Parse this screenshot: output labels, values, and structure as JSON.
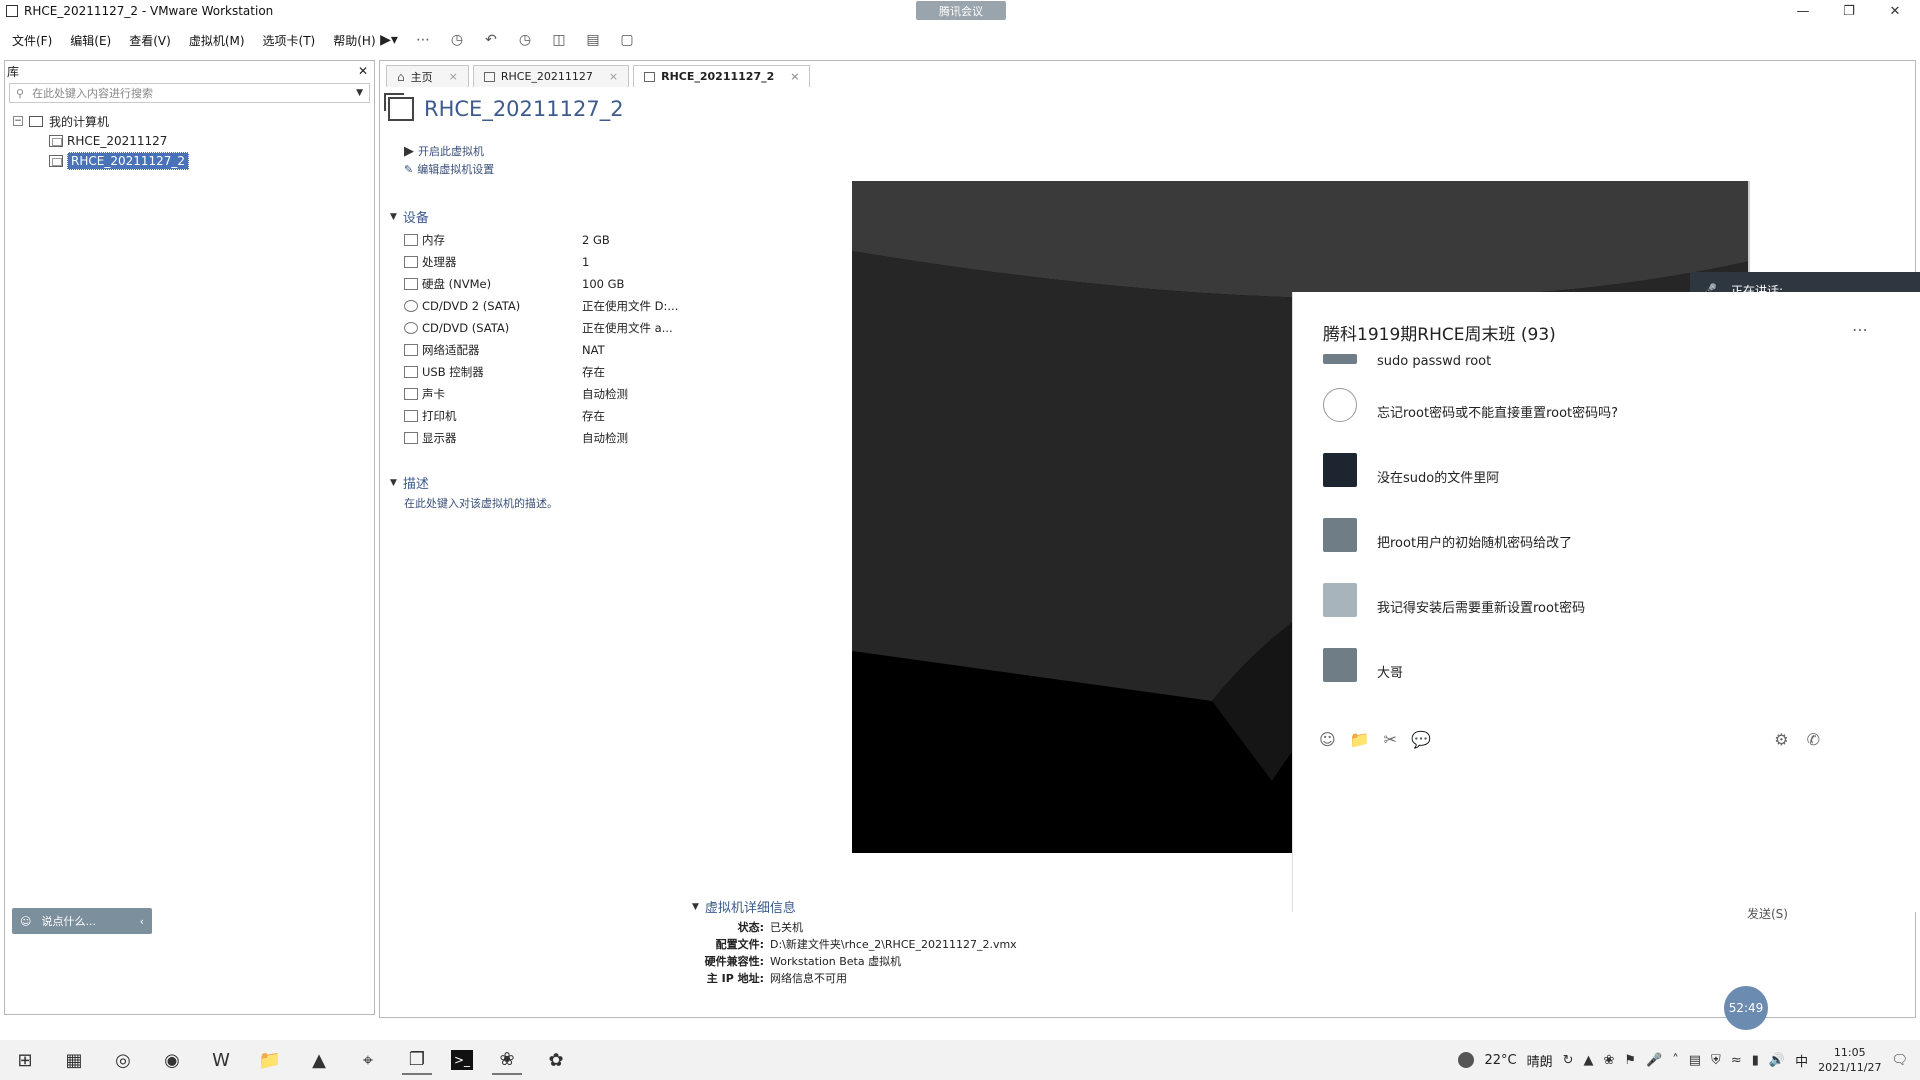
{
  "window": {
    "title": "RHCE_20211127_2 - VMware Workstation",
    "meeting_label": "腾讯会议"
  },
  "menu": [
    "文件(F)",
    "编辑(E)",
    "查看(V)",
    "虚拟机(M)",
    "选项卡(T)",
    "帮助(H)"
  ],
  "library": {
    "title": "库",
    "search_placeholder": "在此处键入内容进行搜索",
    "root": "我的计算机",
    "vms": [
      "RHCE_20211127",
      "RHCE_20211127_2"
    ]
  },
  "say_something": "说点什么...",
  "tabs": [
    {
      "label": "主页"
    },
    {
      "label": "RHCE_20211127"
    },
    {
      "label": "RHCE_20211127_2"
    }
  ],
  "vm": {
    "name": "RHCE_20211127_2",
    "actions": [
      "开启此虚拟机",
      "编辑虚拟机设置"
    ],
    "devices_header": "设备",
    "devices": [
      {
        "name": "内存",
        "value": "2 GB"
      },
      {
        "name": "处理器",
        "value": "1"
      },
      {
        "name": "硬盘 (NVMe)",
        "value": "100 GB"
      },
      {
        "name": "CD/DVD 2 (SATA)",
        "value": "正在使用文件 D:..."
      },
      {
        "name": "CD/DVD (SATA)",
        "value": "正在使用文件 a..."
      },
      {
        "name": "网络适配器",
        "value": "NAT"
      },
      {
        "name": "USB 控制器",
        "value": "存在"
      },
      {
        "name": "声卡",
        "value": "自动检测"
      },
      {
        "name": "打印机",
        "value": "存在"
      },
      {
        "name": "显示器",
        "value": "自动检测"
      }
    ],
    "description_header": "描述",
    "description_placeholder": "在此处键入对该虚拟机的描述。",
    "details_header": "虚拟机详细信息",
    "details": [
      {
        "label": "状态:",
        "value": "已关机"
      },
      {
        "label": "配置文件:",
        "value": "D:\\新建文件夹\\rhce_2\\RHCE_20211127_2.vmx"
      },
      {
        "label": "硬件兼容性:",
        "value": "Workstation Beta 虚拟机"
      },
      {
        "label": "主 IP 地址:",
        "value": "网络信息不可用"
      }
    ]
  },
  "meeting": {
    "speaking": "正在讲话:",
    "chat_title": "腾科1919期RHCE周末班 (93)",
    "messages": [
      {
        "text": "sudo passwd root"
      },
      {
        "text": "忘记root密码或不能直接重置root密码吗?"
      },
      {
        "text": "没在sudo的文件里阿"
      },
      {
        "text": "把root用户的初始随机密码给改了"
      },
      {
        "text": "我记得安装后需要重新设置root密码"
      },
      {
        "text": "大哥"
      }
    ],
    "send": "发送(S)",
    "timer": "52:49"
  },
  "taskbar": {
    "temperature": "22°C",
    "weather": "晴朗",
    "ime": "中",
    "time": "11:05",
    "date": "2021/11/27"
  },
  "colors": {
    "accent": "#3d5b8d",
    "selection": "#4a72b8",
    "vm_screen": "#000000"
  }
}
